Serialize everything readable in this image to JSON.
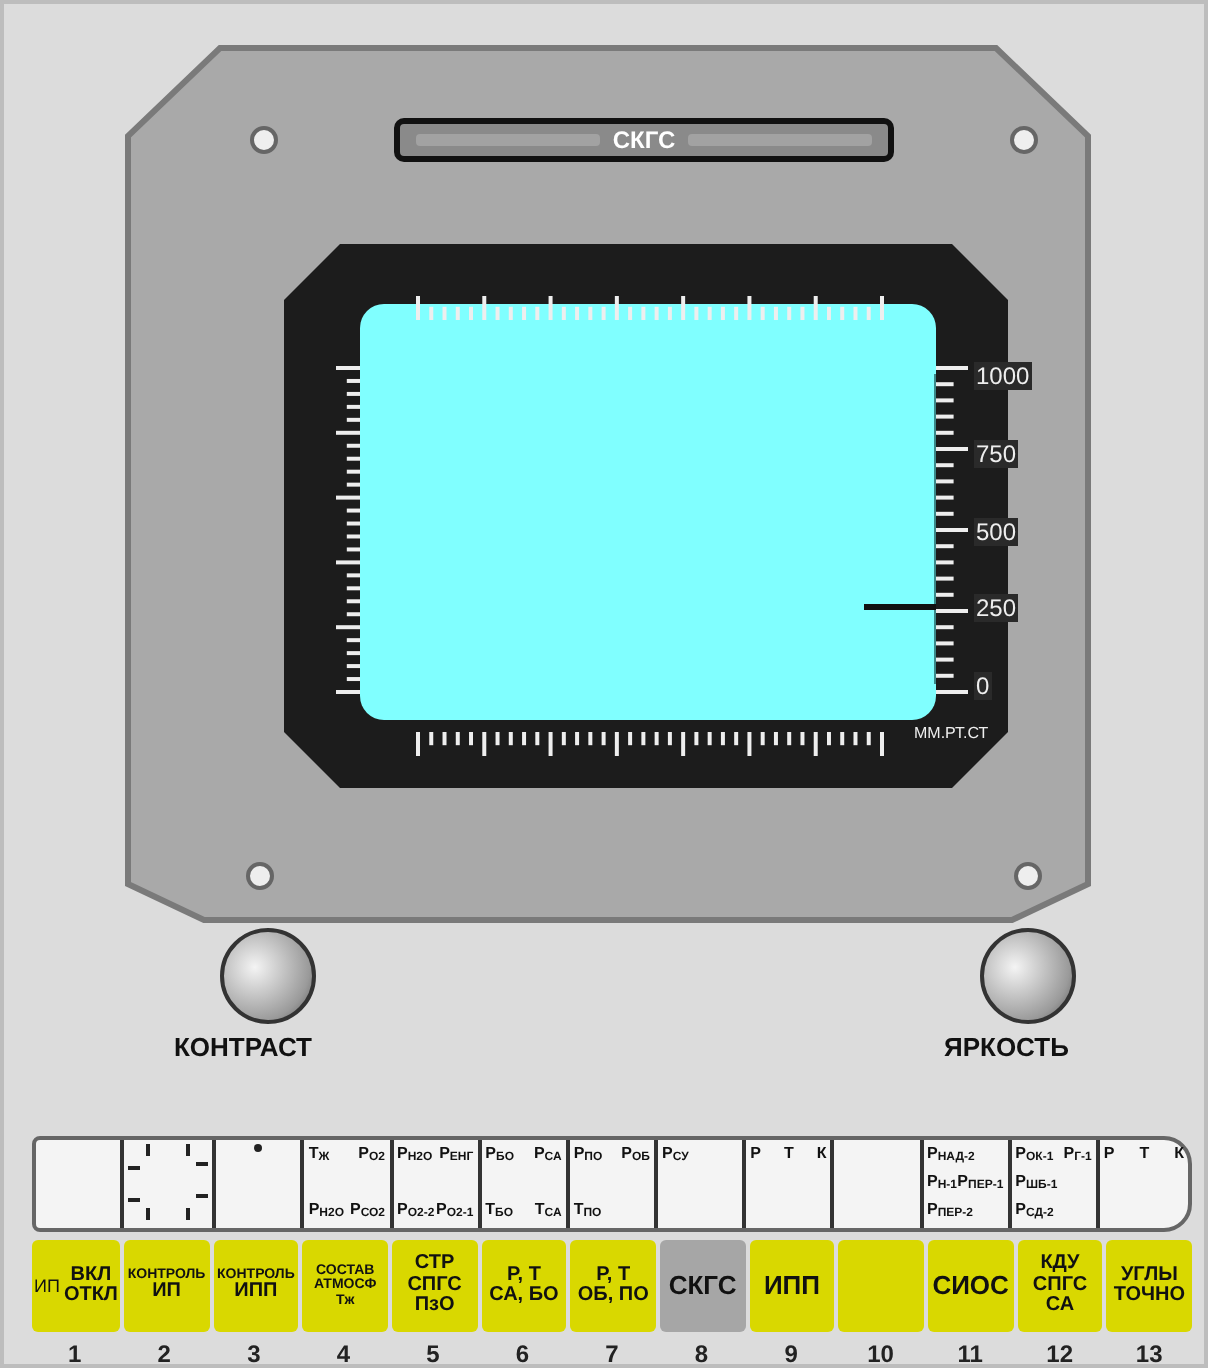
{
  "indicator_strip": {
    "lit_label": "СКГС"
  },
  "gauge": {
    "level": 0.25,
    "scale_labels": [
      "1000",
      "750",
      "500",
      "250",
      "0"
    ],
    "unit": "ММ.РТ.СТ"
  },
  "knobs": [
    {
      "label": "КОНТРАСТ"
    },
    {
      "label": "ЯРКОСТЬ"
    }
  ],
  "format_cells": [
    {
      "kind": "blank"
    },
    {
      "kind": "ticks"
    },
    {
      "kind": "dot"
    },
    {
      "kind": "labels",
      "labels": [
        "Т$_{Ж}$",
        "Р$_{О2}$",
        "Р$_{Н2О}$",
        "Р$_{СО2}$"
      ]
    },
    {
      "kind": "labels",
      "labels": [
        "Р$_{Н2О}$",
        "Р$_{ЕНГ}$",
        "Р$_{О2-2}$",
        "Р$_{О2-1}$"
      ]
    },
    {
      "kind": "labels",
      "labels": [
        "Р$_{БО}$",
        "Р$_{СА}$",
        "Т$_{БО}$",
        "Т$_{СА}$"
      ]
    },
    {
      "kind": "labels",
      "labels": [
        "Р$_{ПО}$",
        "Р$_{ОБ}$",
        "Т$_{ПО}$"
      ]
    },
    {
      "kind": "labels",
      "labels": [
        "Р$_{СУ}$"
      ]
    },
    {
      "kind": "labels",
      "labels": [
        "Р",
        "Т",
        "К"
      ]
    },
    {
      "kind": "blank"
    },
    {
      "kind": "labels",
      "labels": [
        "Р$_{НАД-2}$",
        "Р$_{Н-1}$",
        "Р$_{ПЕР-1}$",
        "Р$_{ПЕР-2}$"
      ]
    },
    {
      "kind": "labels",
      "labels": [
        "Р$_{ОК-1}$",
        "Р$_{Г-1}$",
        "Р$_{ШБ-1}$",
        "Р$_{СД-2}$"
      ]
    },
    {
      "kind": "labels",
      "labels": [
        "Р",
        "Т",
        "К"
      ]
    }
  ],
  "buttons": [
    {
      "number": "1",
      "selected": false,
      "prefix": "ИП",
      "lines": [
        {
          "text": "ВКЛ",
          "kind": "heading"
        },
        {
          "text": "ОТКЛ",
          "kind": "heading"
        }
      ]
    },
    {
      "number": "2",
      "selected": false,
      "lines": [
        {
          "text": "КОНТРОЛЬ",
          "kind": "caption"
        },
        {
          "text": "ИП",
          "kind": "heading"
        }
      ]
    },
    {
      "number": "3",
      "selected": false,
      "lines": [
        {
          "text": "КОНТРОЛЬ",
          "kind": "caption"
        },
        {
          "text": "ИПП",
          "kind": "heading"
        }
      ]
    },
    {
      "number": "4",
      "selected": false,
      "lines": [
        {
          "text": "СОСТАВ",
          "kind": "caption"
        },
        {
          "text": "АТМОСФ",
          "kind": "caption"
        },
        {
          "text": "Тж",
          "kind": "caption"
        }
      ]
    },
    {
      "number": "5",
      "selected": false,
      "lines": [
        {
          "text": "СТР",
          "kind": "heading"
        },
        {
          "text": "СПГС",
          "kind": "heading"
        },
        {
          "text": "ПзО",
          "kind": "heading"
        }
      ]
    },
    {
      "number": "6",
      "selected": false,
      "lines": [
        {
          "text": "Р, Т",
          "kind": "heading"
        },
        {
          "text": "СА, БО",
          "kind": "heading"
        }
      ]
    },
    {
      "number": "7",
      "selected": false,
      "lines": [
        {
          "text": "Р, Т",
          "kind": "heading"
        },
        {
          "text": "ОБ, ПО",
          "kind": "heading"
        }
      ]
    },
    {
      "number": "8",
      "selected": true,
      "lines": [
        {
          "text": "СКГС",
          "kind": "title"
        }
      ]
    },
    {
      "number": "9",
      "selected": false,
      "lines": [
        {
          "text": "ИПП",
          "kind": "title"
        }
      ]
    },
    {
      "number": "10",
      "selected": false
    },
    {
      "number": "11",
      "selected": false,
      "lines": [
        {
          "text": "СИОС",
          "kind": "title"
        }
      ]
    },
    {
      "number": "12",
      "selected": false,
      "lines": [
        {
          "text": "КДУ",
          "kind": "heading"
        },
        {
          "text": "СПГС",
          "kind": "heading"
        },
        {
          "text": "СА",
          "kind": "heading"
        }
      ]
    },
    {
      "number": "13",
      "selected": false,
      "lines": [
        {
          "text": "УГЛЫ",
          "kind": "heading"
        },
        {
          "text": "ТОЧНО",
          "kind": "heading"
        }
      ]
    }
  ]
}
